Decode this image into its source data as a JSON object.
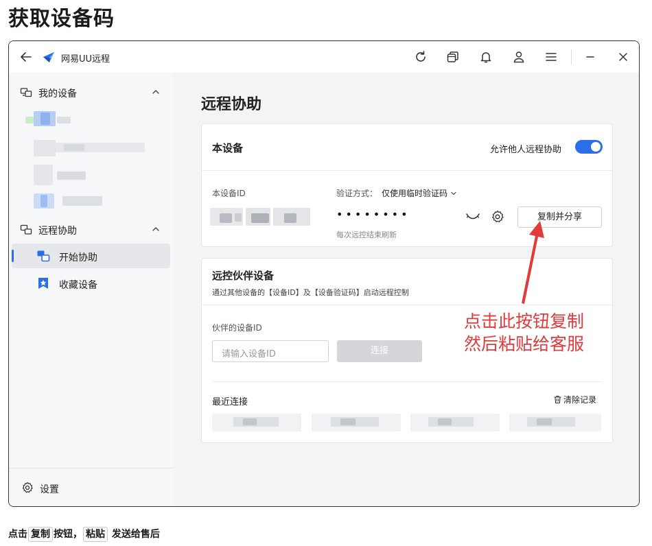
{
  "page": {
    "heading": "获取设备码",
    "footer": {
      "part1": "点击",
      "key1": "复制",
      "part2": "按钮，",
      "key2": "粘贴",
      "part3": "发送给售后"
    }
  },
  "window": {
    "title": "网易UU远程",
    "titlebar_icons": [
      "back-arrow-icon",
      "refresh-icon",
      "window-switch-icon",
      "bell-icon",
      "user-icon",
      "menu-icon",
      "minimize-icon",
      "close-icon"
    ]
  },
  "sidebar": {
    "my_devices": {
      "label": "我的设备",
      "icon": "devices-icon"
    },
    "remote_assist": {
      "label": "远程协助",
      "icon": "remote-assist-icon"
    },
    "items": [
      {
        "label": "开始协助",
        "icon": "start-assist-icon",
        "active": true
      },
      {
        "label": "收藏设备",
        "icon": "favorite-star-icon",
        "active": false
      }
    ],
    "settings_label": "设置"
  },
  "main": {
    "title": "远程协助",
    "this_device": {
      "title": "本设备",
      "allow_label": "允许他人远程协助",
      "allow_enabled": true,
      "device_id_label": "本设备ID",
      "verify_label": "验证方式：",
      "verify_value": "仅使用临时验证码",
      "password_mask": "••••••••",
      "refresh_note": "每次远控结束刷新",
      "copy_button": "复制并分享"
    },
    "partner": {
      "title": "远控伙伴设备",
      "subtitle": "通过其他设备的【设备ID】及【设备验证码】启动远程控制",
      "id_label": "伙伴的设备ID",
      "id_placeholder": "请输入设备ID",
      "connect_button": "连接",
      "recent_label": "最近连接",
      "clear_label": "清除记录"
    }
  },
  "annotation": {
    "line1": "点击此按钮复制",
    "line2": "然后粘贴给客服",
    "color": "#e33b3b"
  },
  "colors": {
    "accent": "#2b6fe8",
    "sidebar_bg": "#f6f7f8",
    "content_bg": "#f3f4f6"
  }
}
